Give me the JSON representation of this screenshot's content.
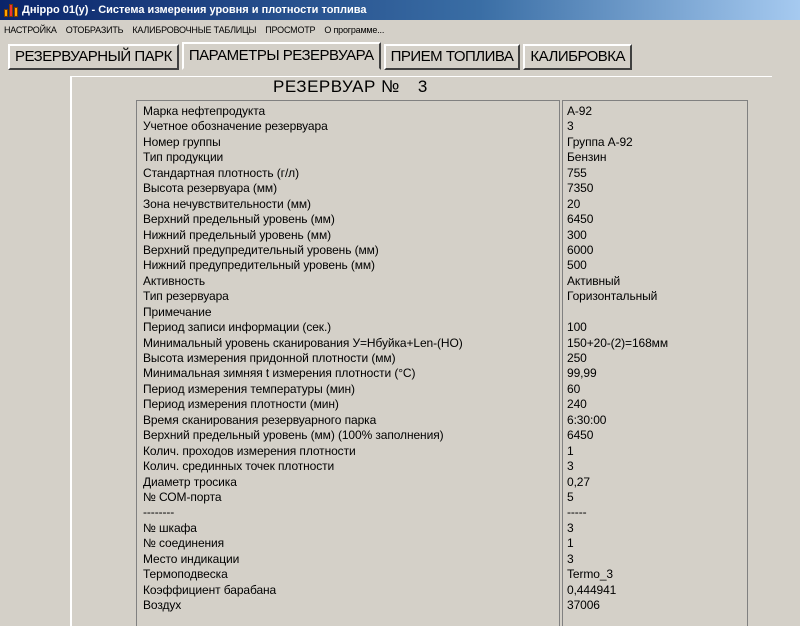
{
  "window": {
    "title": "Днipро 01(у) - Система измерения уровня и плотности топлива"
  },
  "menu": [
    "НАСТРОЙКА",
    "ОТОБРАЗИТЬ",
    "КАЛИБРОВОЧНЫЕ ТАБЛИЦЫ",
    "ПРОСМОТР",
    "О программе..."
  ],
  "tabs": [
    {
      "label": "РЕЗЕРВУАРНЫЙ ПАРК",
      "active": false
    },
    {
      "label": "ПАРАМЕТРЫ РЕЗЕРВУАРА",
      "active": true
    },
    {
      "label": "ПРИЕМ ТОПЛИВА",
      "active": false
    },
    {
      "label": "КАЛИБРОВКА",
      "active": false
    }
  ],
  "reservoir": {
    "title": "РЕЗЕРВУАР №",
    "number": "3"
  },
  "params": {
    "labels": [
      "Марка нефтепродукта",
      "Учетное обозначение резервуара",
      "Номер группы",
      "Тип продукции",
      "Стандартная плотность (г/л)",
      "Высота резервуара (мм)",
      "Зона нечувствительности (мм)",
      "Верхний предельный уровень (мм)",
      "Нижний предельный уровень (мм)",
      "Верхний предупредительный уровень (мм)",
      "Нижний предупредительный уровень (мм)",
      "Активность",
      "Тип резервуара",
      "Примечание",
      "Период записи информации (сек.)",
      "Минимальный уровень сканирования У=Нбуйка+Len-(НО)",
      "Высота измерения придонной плотности (мм)",
      "Минимальная зимняя t измерения плотности (°С)",
      "Период измерения температуры (мин)",
      "Период измерения плотности (мин)",
      "Время сканирования резервуарного парка",
      "Верхний предельный уровень (мм) (100% заполнения)",
      "Колич. проходов измерения плотности",
      "Колич. срединных точек плотности",
      "Диаметр тросика",
      "№ СОМ-порта",
      "--------",
      "№ шкафа",
      "№ соединения",
      "Место индикации",
      "Термоподвеска",
      "Коэффициент барабана",
      "Воздух"
    ],
    "values": [
      "А-92",
      "3",
      "Группа А-92",
      "Бензин",
      "755",
      "7350",
      "20",
      "6450",
      "300",
      "6000",
      "500",
      "Активный",
      "Горизонтальный",
      "",
      "100",
      "150+20-(2)=168мм",
      "250",
      "99,99",
      "60",
      "240",
      "6:30:00",
      "6450",
      "1",
      "3",
      "0,27",
      "5",
      "-----",
      "3",
      "1",
      "3",
      "Termo_3",
      "0,444941",
      "37006"
    ]
  }
}
